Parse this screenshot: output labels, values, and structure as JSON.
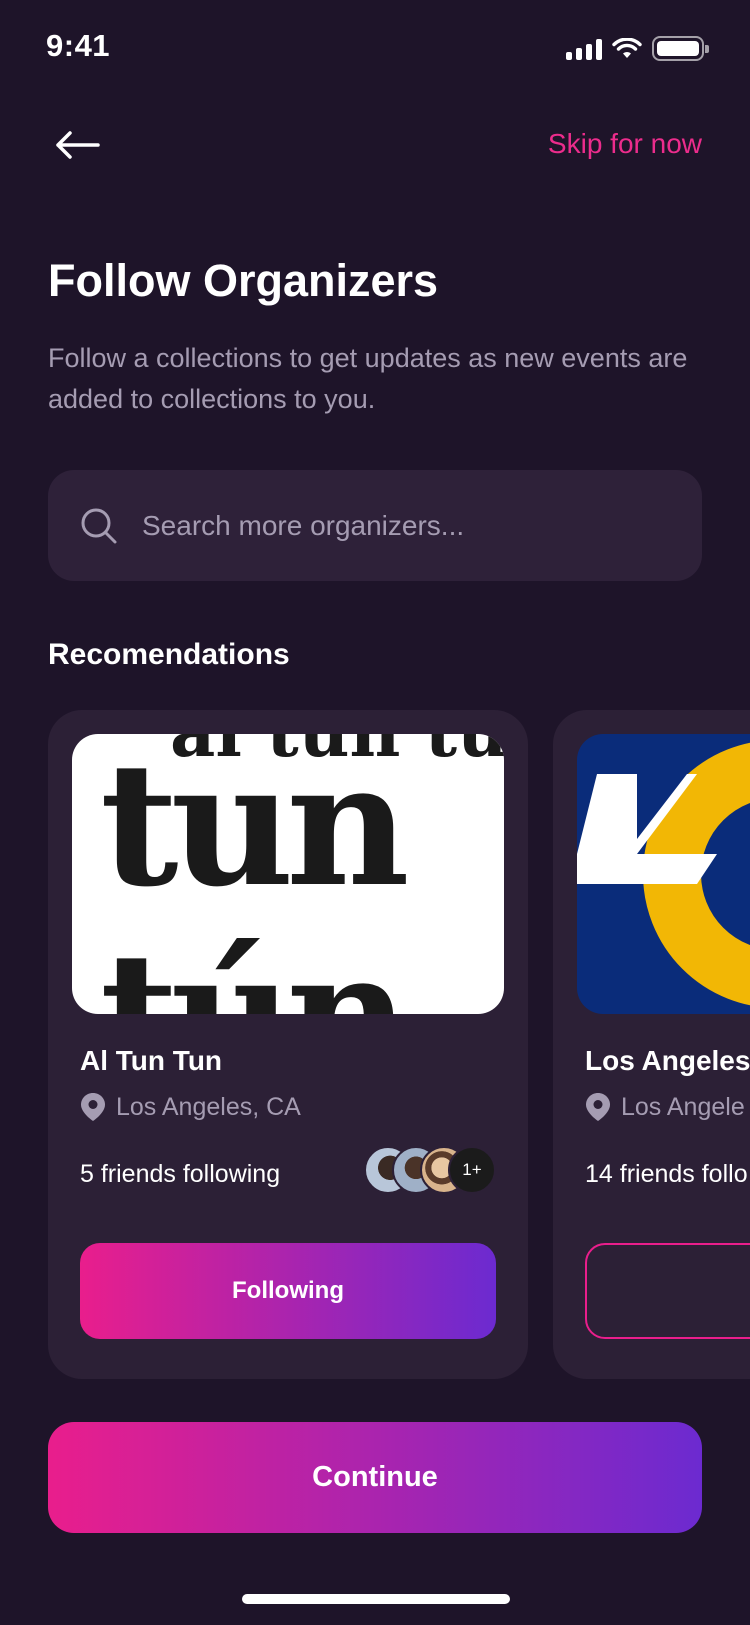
{
  "status_bar": {
    "time": "9:41"
  },
  "nav": {
    "skip_label": "Skip for now"
  },
  "header": {
    "title": "Follow Organizers",
    "subtitle": "Follow a collections to get updates as new events are added to collections to you."
  },
  "search": {
    "placeholder": "Search more organizers..."
  },
  "recommendations": {
    "title": "Recomendations",
    "cards": [
      {
        "name": "Al Tun Tun",
        "logo_text": "al tun tún",
        "location": "Los Angeles, CA",
        "friends": "5 friends following",
        "avatars_more": "1+",
        "button_label": "Following"
      },
      {
        "name": "Los Angeles",
        "location": "Los Angele",
        "friends": "14 friends follo",
        "button_label": ""
      }
    ]
  },
  "footer": {
    "continue_label": "Continue"
  },
  "colors": {
    "background": "#1E1429",
    "card": "#2C2036",
    "accent_pink": "#E91E8C",
    "accent_purple": "#6C2AD0",
    "muted_text": "#A59CB2"
  }
}
